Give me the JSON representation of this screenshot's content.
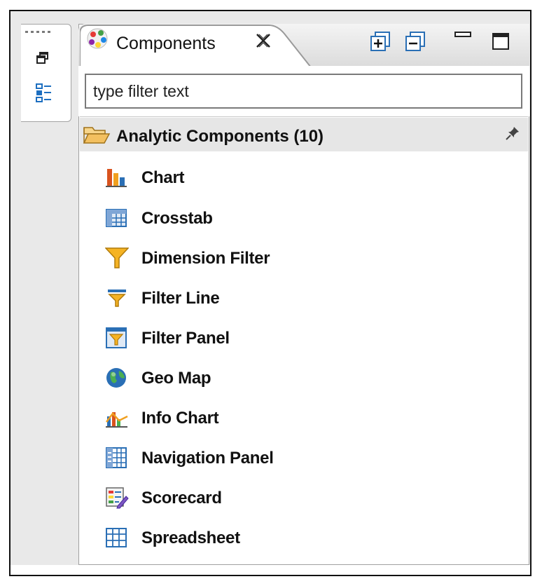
{
  "view": {
    "title": "Components",
    "filter": {
      "placeholder": "type filter text",
      "value": ""
    },
    "category": {
      "label": "Analytic Components (10)",
      "items": [
        {
          "label": "Chart",
          "icon": "chart-icon"
        },
        {
          "label": "Crosstab",
          "icon": "crosstab-icon"
        },
        {
          "label": "Dimension Filter",
          "icon": "dimension-filter-icon"
        },
        {
          "label": "Filter Line",
          "icon": "filter-line-icon"
        },
        {
          "label": "Filter Panel",
          "icon": "filter-panel-icon"
        },
        {
          "label": "Geo Map",
          "icon": "globe-icon"
        },
        {
          "label": "Info Chart",
          "icon": "info-chart-icon"
        },
        {
          "label": "Navigation Panel",
          "icon": "navigation-panel-icon"
        },
        {
          "label": "Scorecard",
          "icon": "scorecard-icon"
        },
        {
          "label": "Spreadsheet",
          "icon": "spreadsheet-icon"
        }
      ]
    }
  },
  "colors": {
    "frame": "#111111",
    "trim": "#e9e9e9",
    "category_bg": "#e6e6e6",
    "icon_blue": "#2a6fb5",
    "icon_orange": "#f0a020"
  }
}
